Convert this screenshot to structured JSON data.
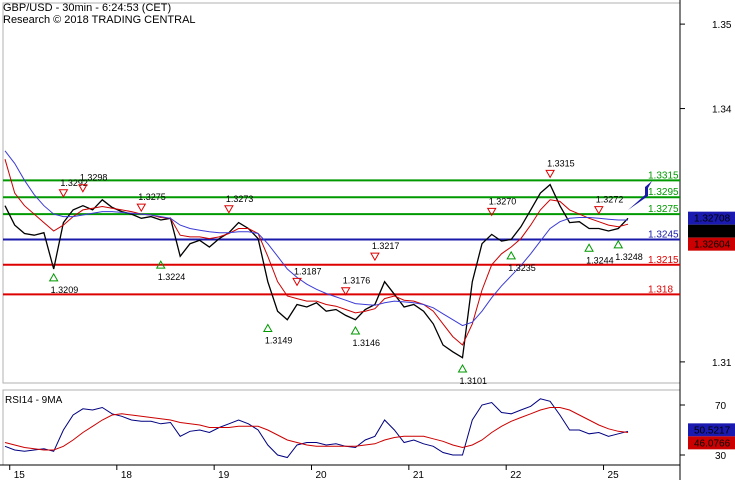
{
  "header": {
    "line1": "GBP/USD - 30min - 6:24:53 (CET)",
    "line2": "Research © 2018 TRADING CENTRAL"
  },
  "chart_data": [
    {
      "type": "line",
      "title": "GBP/USD - 30min",
      "y_ticks": [
        "1.35",
        "1.34",
        "1.31"
      ],
      "ylim": [
        1.3075,
        1.3525
      ],
      "x_ticks": [
        "15",
        "18",
        "19",
        "20",
        "21",
        "22",
        "25"
      ],
      "series": [
        {
          "name": "price",
          "color": "#000000",
          "values": [
            1.3285,
            1.3262,
            1.3252,
            1.325,
            1.3253,
            1.321,
            1.3265,
            1.328,
            1.3285,
            1.328,
            1.3292,
            1.3283,
            1.3278,
            1.3275,
            1.327,
            1.3272,
            1.3268,
            1.327,
            1.3225,
            1.324,
            1.3244,
            1.3236,
            1.3246,
            1.3253,
            1.3265,
            1.3258,
            1.3246,
            1.3195,
            1.316,
            1.315,
            1.3168,
            1.3165,
            1.317,
            1.316,
            1.3162,
            1.3155,
            1.315,
            1.3162,
            1.3168,
            1.3195,
            1.318,
            1.3165,
            1.3168,
            1.316,
            1.3145,
            1.312,
            1.3112,
            1.3105,
            1.3195,
            1.324,
            1.3251,
            1.3243,
            1.3245,
            1.326,
            1.328,
            1.33,
            1.331,
            1.3285,
            1.3265,
            1.3266,
            1.3258,
            1.3258,
            1.3255,
            1.3258,
            1.327
          ]
        },
        {
          "name": "ma-fast",
          "color": "#cc0000",
          "values": [
            1.334,
            1.33,
            1.3285,
            1.3275,
            1.3265,
            1.3255,
            1.3262,
            1.3272,
            1.328,
            1.3282,
            1.3284,
            1.3282,
            1.328,
            1.3278,
            1.3275,
            1.3274,
            1.3271,
            1.327,
            1.325,
            1.3248,
            1.3248,
            1.3246,
            1.3248,
            1.3252,
            1.3258,
            1.3258,
            1.3252,
            1.3225,
            1.3195,
            1.3178,
            1.3175,
            1.3172,
            1.3172,
            1.3168,
            1.3166,
            1.3162,
            1.3158,
            1.316,
            1.3163,
            1.3175,
            1.3178,
            1.3173,
            1.3172,
            1.3168,
            1.316,
            1.3145,
            1.313,
            1.312,
            1.3145,
            1.3185,
            1.3215,
            1.3228,
            1.3236,
            1.3246,
            1.3262,
            1.328,
            1.3292,
            1.329,
            1.328,
            1.3275,
            1.327,
            1.3266,
            1.3262,
            1.326,
            1.3263
          ]
        },
        {
          "name": "ma-slow",
          "color": "#3b3bd6",
          "values": [
            1.335,
            1.3335,
            1.3315,
            1.3298,
            1.3285,
            1.3275,
            1.3272,
            1.3272,
            1.3274,
            1.3276,
            1.3278,
            1.3278,
            1.3277,
            1.3276,
            1.3275,
            1.3274,
            1.3272,
            1.327,
            1.3262,
            1.3258,
            1.3256,
            1.3254,
            1.3253,
            1.3253,
            1.3254,
            1.3254,
            1.3252,
            1.324,
            1.3225,
            1.321,
            1.32,
            1.3192,
            1.3186,
            1.3181,
            1.3177,
            1.3173,
            1.3169,
            1.3168,
            1.3167,
            1.317,
            1.3172,
            1.3171,
            1.317,
            1.3168,
            1.3164,
            1.3157,
            1.315,
            1.3143,
            1.3147,
            1.316,
            1.3176,
            1.319,
            1.3202,
            1.3214,
            1.3228,
            1.3243,
            1.3258,
            1.3266,
            1.327,
            1.3271,
            1.3271,
            1.327,
            1.3269,
            1.3268,
            1.3268
          ]
        }
      ],
      "levels": [
        {
          "value": 1.3315,
          "label": "1.3315",
          "color": "#009900"
        },
        {
          "value": 1.3295,
          "label": "1.3295",
          "color": "#009900"
        },
        {
          "value": 1.3275,
          "label": "1.3275",
          "color": "#009900"
        },
        {
          "value": 1.3245,
          "label": "1.3245",
          "color": "#1a1aaa"
        },
        {
          "value": 1.3215,
          "label": "1.3215",
          "color": "#dd0000"
        },
        {
          "value": 1.318,
          "label": "1.318",
          "color": "#dd0000"
        }
      ],
      "price_tags": [
        {
          "label": "1.32708",
          "value": 1.32708,
          "bg": "#1a1ab0",
          "fg": "#ffffff"
        },
        {
          "label": "1.3263",
          "value": 1.3263,
          "bg": "#000000",
          "fg": "#ffffff"
        },
        {
          "label": "1.32604",
          "value": 1.32604,
          "bg": "#cc0000",
          "fg": "#ffffff"
        }
      ],
      "annotations": [
        {
          "label": "1.3292",
          "value": 1.3292,
          "kind": "high",
          "i": 6
        },
        {
          "label": "1.3298",
          "value": 1.3298,
          "kind": "high",
          "i": 8
        },
        {
          "label": "1.3275",
          "value": 1.3275,
          "kind": "high",
          "i": 14
        },
        {
          "label": "1.3273",
          "value": 1.3273,
          "kind": "high",
          "i": 23
        },
        {
          "label": "1.3187",
          "value": 1.3187,
          "kind": "high",
          "i": 30
        },
        {
          "label": "1.3176",
          "value": 1.3176,
          "kind": "high",
          "i": 35
        },
        {
          "label": "1.3217",
          "value": 1.3217,
          "kind": "high",
          "i": 38
        },
        {
          "label": "1.3270",
          "value": 1.327,
          "kind": "high",
          "i": 50
        },
        {
          "label": "1.3315",
          "value": 1.3315,
          "kind": "high",
          "i": 56
        },
        {
          "label": "1.3272",
          "value": 1.3272,
          "kind": "high",
          "i": 61
        },
        {
          "label": "1.3209",
          "value": 1.3209,
          "kind": "low",
          "i": 5
        },
        {
          "label": "1.3224",
          "value": 1.3224,
          "kind": "low",
          "i": 16
        },
        {
          "label": "1.3149",
          "value": 1.3149,
          "kind": "low",
          "i": 27
        },
        {
          "label": "1.3146",
          "value": 1.3146,
          "kind": "low",
          "i": 36
        },
        {
          "label": "1.3101",
          "value": 1.3101,
          "kind": "low",
          "i": 47
        },
        {
          "label": "1.3235",
          "value": 1.3235,
          "kind": "low",
          "i": 52
        },
        {
          "label": "1.3244",
          "value": 1.3244,
          "kind": "low",
          "i": 60
        },
        {
          "label": "1.3248",
          "value": 1.3248,
          "kind": "low",
          "i": 63
        }
      ]
    },
    {
      "type": "line",
      "title": "RSI14 - 9MA",
      "y_ticks": [
        "70",
        "30"
      ],
      "ylim": [
        22,
        82
      ],
      "series": [
        {
          "name": "RSI14",
          "color": "#000080",
          "values": [
            37,
            34,
            33,
            34,
            35,
            33,
            50,
            62,
            67,
            66,
            68,
            63,
            61,
            58,
            57,
            57,
            55,
            56,
            45,
            49,
            50,
            48,
            52,
            55,
            58,
            55,
            50,
            38,
            30,
            28,
            38,
            40,
            40,
            38,
            39,
            37,
            36,
            42,
            45,
            58,
            50,
            40,
            42,
            39,
            37,
            32,
            30,
            30,
            58,
            70,
            72,
            64,
            63,
            66,
            69,
            75,
            73,
            62,
            50,
            50,
            47,
            48,
            45,
            47,
            49
          ]
        },
        {
          "name": "9MA",
          "color": "#cc0000",
          "values": [
            40,
            38,
            36,
            35,
            34,
            34,
            37,
            42,
            48,
            53,
            58,
            62,
            63,
            62,
            61,
            60,
            59,
            58,
            56,
            55,
            54,
            52,
            52,
            52,
            53,
            53,
            53,
            50,
            46,
            42,
            40,
            38,
            37,
            37,
            37,
            37,
            37,
            38,
            39,
            42,
            44,
            45,
            45,
            45,
            43,
            41,
            38,
            36,
            38,
            42,
            48,
            53,
            57,
            60,
            63,
            66,
            68,
            68,
            66,
            62,
            58,
            54,
            51,
            49,
            48
          ]
        }
      ],
      "price_tags": [
        {
          "label": "50.5217",
          "value": 50.5217,
          "bg": "#1a1ab0",
          "fg": "#ffffff"
        },
        {
          "label": "46.0766",
          "value": 46.0766,
          "bg": "#cc0000",
          "fg": "#ffffff"
        }
      ]
    }
  ]
}
